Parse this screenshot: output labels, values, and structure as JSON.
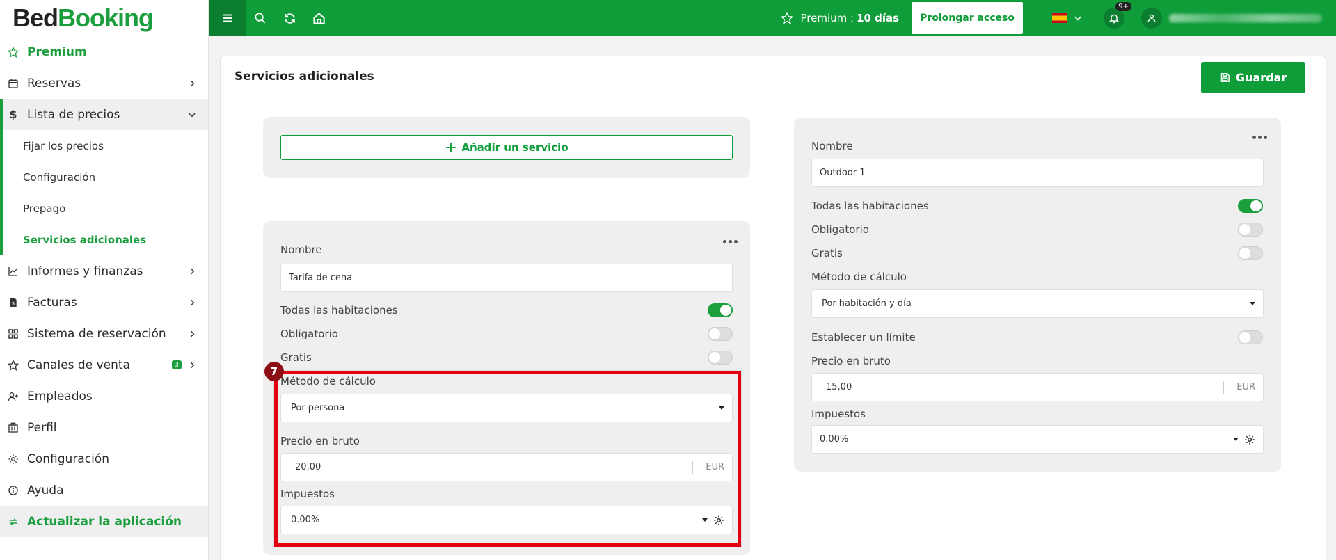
{
  "logo": {
    "part1": "Bed",
    "part2": "Booking"
  },
  "sidebar": {
    "items": [
      {
        "label": "Premium",
        "icon": "star-icon"
      },
      {
        "label": "Reservas",
        "icon": "calendar-icon"
      },
      {
        "label": "Lista de precios",
        "icon": "dollar-icon"
      },
      {
        "label": "Informes y finanzas",
        "icon": "chart-icon"
      },
      {
        "label": "Facturas",
        "icon": "invoice-icon"
      },
      {
        "label": "Sistema de reservación",
        "icon": "grid-icon"
      },
      {
        "label": "Canales de venta",
        "icon": "star-icon",
        "badge": "3"
      },
      {
        "label": "Empleados",
        "icon": "user-plus-icon"
      },
      {
        "label": "Perfil",
        "icon": "building-icon"
      },
      {
        "label": "Configuración",
        "icon": "gear-icon"
      },
      {
        "label": "Ayuda",
        "icon": "info-icon"
      },
      {
        "label": "Actualizar la aplicación",
        "icon": "refresh-icon"
      }
    ],
    "subitems": [
      {
        "label": "Fijar los precios"
      },
      {
        "label": "Configuración"
      },
      {
        "label": "Prepago"
      },
      {
        "label": "Servicios adicionales"
      }
    ]
  },
  "topbar": {
    "premium_label": "Premium :",
    "premium_days": "10 días",
    "prolong_label": "Prolongar acceso",
    "notif_count": "9+"
  },
  "main": {
    "title": "Servicios adicionales",
    "save_label": "Guardar",
    "add_service_label": "Añadir un servicio",
    "highlight_step": "7"
  },
  "service1": {
    "name_label": "Nombre",
    "name_value": "Tarifa de cena",
    "all_rooms_label": "Todas las habitaciones",
    "mandatory_label": "Obligatorio",
    "free_label": "Gratis",
    "method_label": "Método de cálculo",
    "method_value": "Por persona",
    "price_label": "Precio en bruto",
    "price_value": "20,00",
    "currency": "EUR",
    "tax_label": "Impuestos",
    "tax_value": "0.00%",
    "all_rooms_on": true,
    "mandatory_on": false,
    "free_on": false
  },
  "service2": {
    "name_label": "Nombre",
    "name_value": "Outdoor 1",
    "all_rooms_label": "Todas las habitaciones",
    "mandatory_label": "Obligatorio",
    "free_label": "Gratis",
    "method_label": "Método de cálculo",
    "method_value": "Por habitación y día",
    "limit_label": "Establecer un límite",
    "price_label": "Precio en bruto",
    "price_value": "15,00",
    "currency": "EUR",
    "tax_label": "Impuestos",
    "tax_value": "0.00%",
    "all_rooms_on": true,
    "mandatory_on": false,
    "free_on": false,
    "limit_on": false
  },
  "colors": {
    "brand_green": "#0f9d3a",
    "highlight_red": "#e0000f",
    "step_badge": "#8c0d14"
  }
}
